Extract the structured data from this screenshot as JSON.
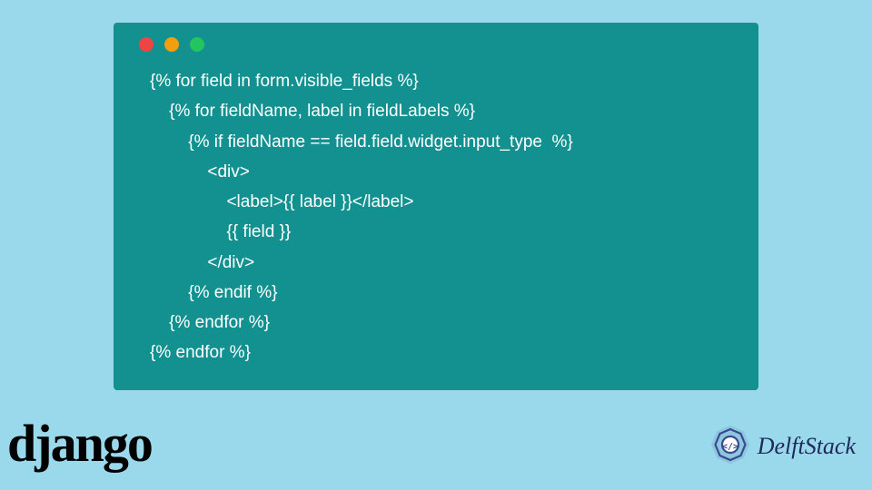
{
  "code": {
    "lines": [
      "{% for field in form.visible_fields %}",
      "    {% for fieldName, label in fieldLabels %}",
      "        {% if fieldName == field.field.widget.input_type  %}",
      "            <div>",
      "                <label>{{ label }}</label>",
      "                {{ field }}",
      "            </div>",
      "        {% endif %}",
      "    {% endfor %}",
      "{% endfor %}"
    ]
  },
  "logos": {
    "django": "django",
    "delftstack": "DelftStack"
  },
  "colors": {
    "bg": "#99d9eb",
    "codebg": "#139191",
    "codetext": "#ffffff"
  }
}
